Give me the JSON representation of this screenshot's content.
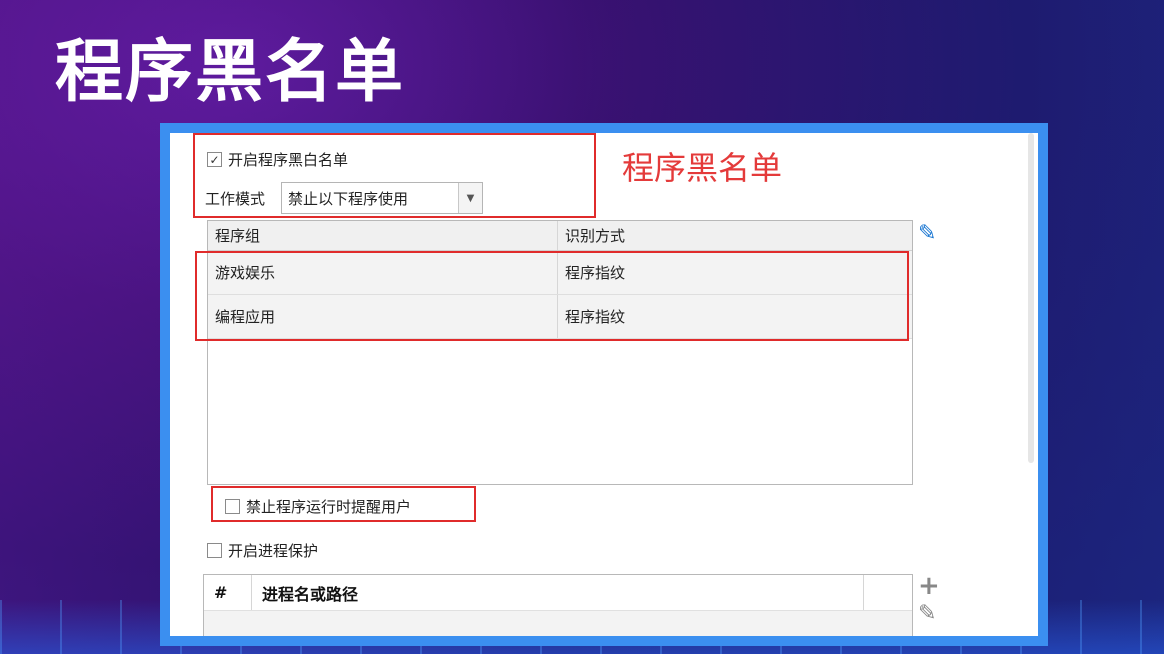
{
  "slide": {
    "title": "程序黑名单"
  },
  "annotation": {
    "text": "程序黑名单",
    "color": "#e43a3a"
  },
  "settings": {
    "enable_blackwhite": {
      "label": "开启程序黑白名单",
      "checked": true
    },
    "work_mode": {
      "label": "工作模式",
      "value": "禁止以下程序使用"
    },
    "notify_user": {
      "label": "禁止程序运行时提醒用户",
      "checked": false
    },
    "process_protect": {
      "label": "开启进程保护",
      "checked": false
    }
  },
  "program_table": {
    "columns": [
      "程序组",
      "识别方式"
    ],
    "rows": [
      {
        "group": "游戏娱乐",
        "method": "程序指纹"
      },
      {
        "group": "编程应用",
        "method": "程序指纹"
      }
    ]
  },
  "process_table": {
    "columns": [
      "#",
      "进程名或路径"
    ]
  },
  "icons": {
    "edit": "pencil-icon",
    "add": "plus-icon",
    "edit2": "pencil-icon"
  },
  "colors": {
    "frame": "#3b8ff0",
    "highlight": "#e02b2b",
    "accent": "#1976d2"
  }
}
